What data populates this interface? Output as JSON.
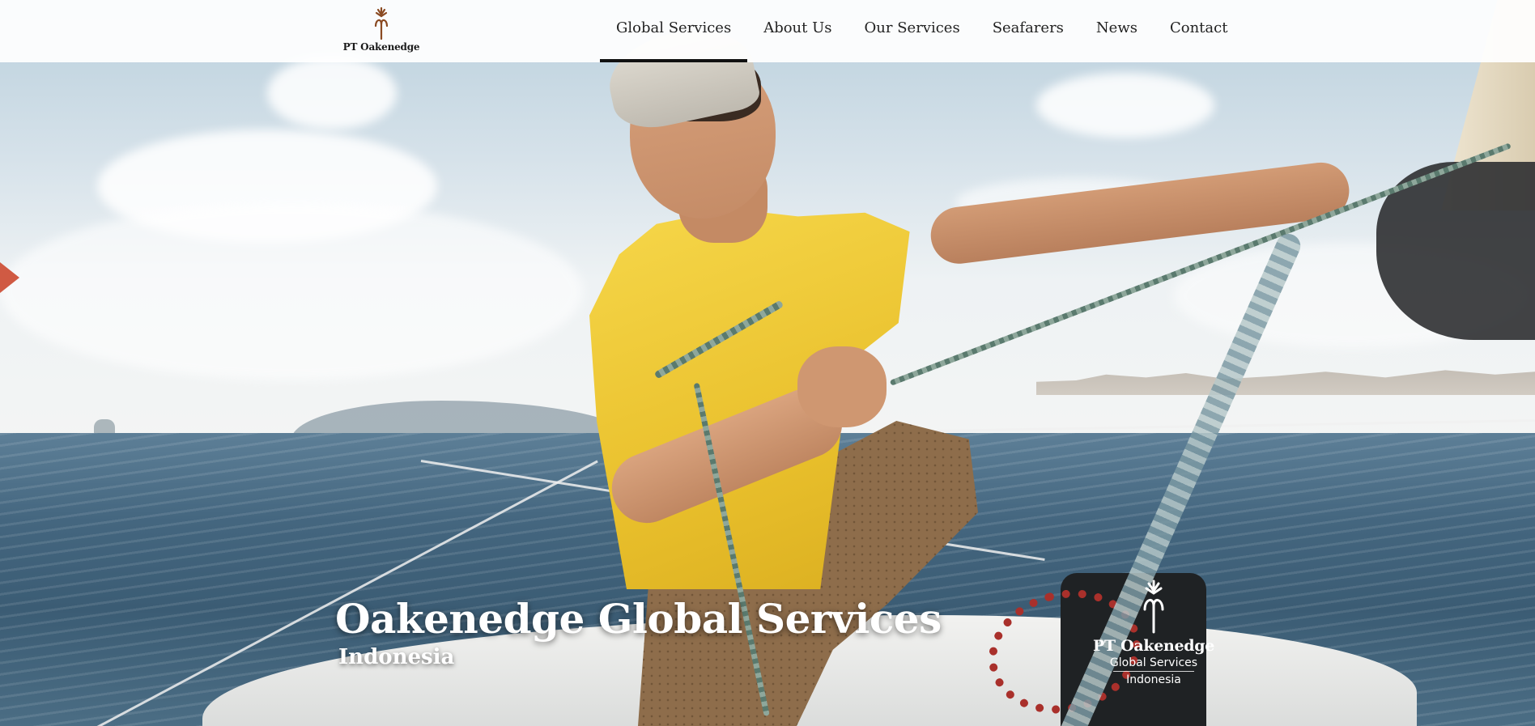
{
  "header": {
    "logo_text": "PT Oakenedge",
    "nav": [
      {
        "label": "Global Services",
        "active": true
      },
      {
        "label": "About Us",
        "active": false
      },
      {
        "label": "Our Services",
        "active": false
      },
      {
        "label": "Seafarers",
        "active": false
      },
      {
        "label": "News",
        "active": false
      },
      {
        "label": "Contact",
        "active": false
      }
    ]
  },
  "hero": {
    "title": "Oakenedge Global Services",
    "subtitle": "Indonesia"
  },
  "watermark": {
    "name": "PT Oakenedge",
    "line1": "Global Services",
    "line2": "Indonesia"
  },
  "colors": {
    "logo_brown": "#8a4a22",
    "nav_active_underline": "#111111",
    "hero_text": "#ffffff"
  }
}
